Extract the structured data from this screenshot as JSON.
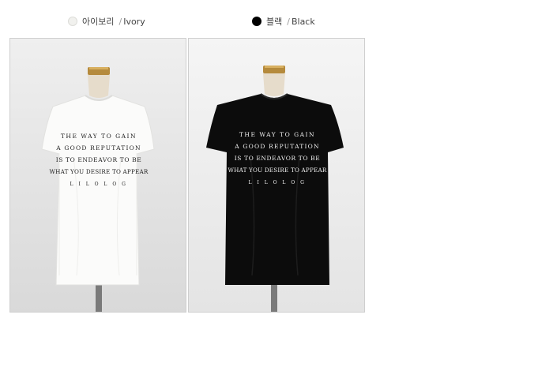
{
  "variants": [
    {
      "name_ko": "아이보리",
      "separator": "/",
      "name_en": "Ivory",
      "swatch_color": "#f1f1ee"
    },
    {
      "name_ko": "블랙",
      "separator": "/",
      "name_en": "Black",
      "swatch_color": "#000000"
    }
  ],
  "tshirt_print": {
    "lines": [
      "THE WAY TO GAIN",
      "A GOOD REPUTATION",
      "IS TO ENDEAVOR TO BE",
      "WHAT YOU DESIRE TO APPEAR",
      "L I L O L O G"
    ]
  }
}
